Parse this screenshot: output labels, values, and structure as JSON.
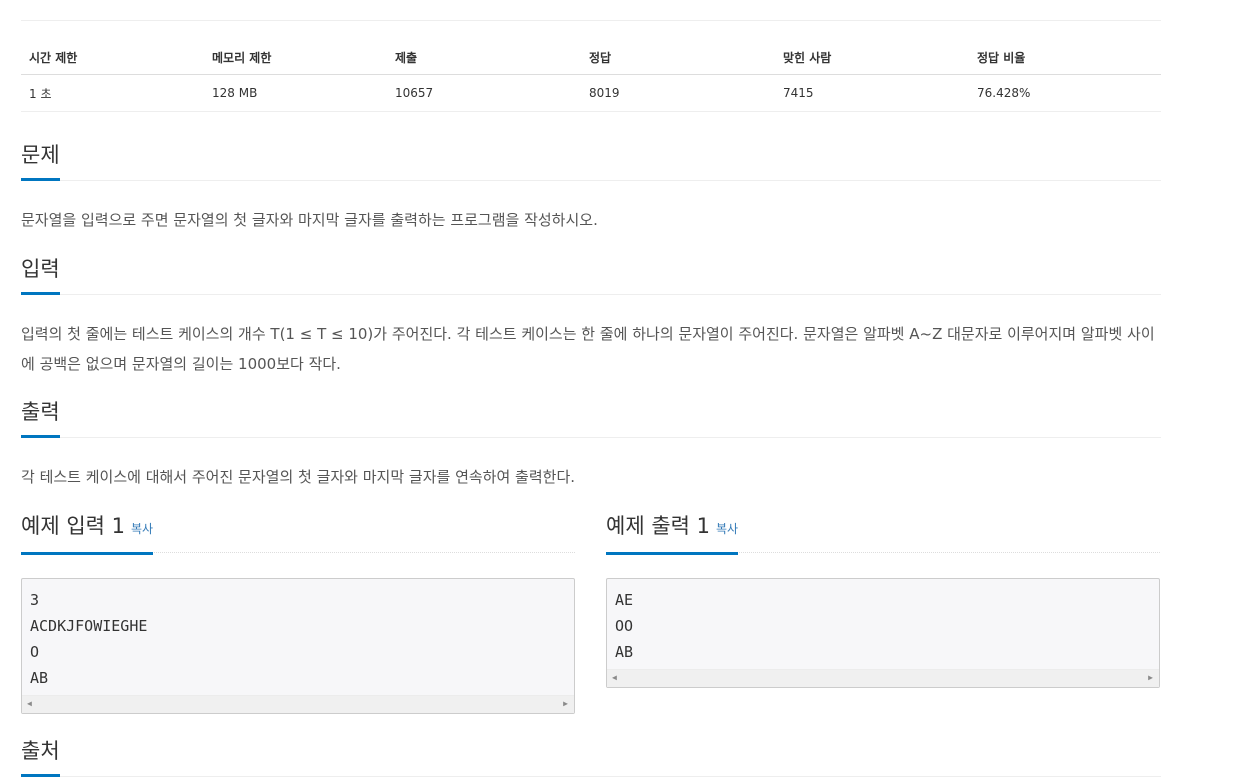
{
  "info_table": {
    "headers": [
      "시간 제한",
      "메모리 제한",
      "제출",
      "정답",
      "맞힌 사람",
      "정답 비율"
    ],
    "values": [
      "1 초",
      "128 MB",
      "10657",
      "8019",
      "7415",
      "76.428%"
    ]
  },
  "sections": {
    "problem": {
      "title": "문제",
      "text": "문자열을 입력으로 주면 문자열의 첫 글자와 마지막 글자를 출력하는 프로그램을 작성하시오."
    },
    "input": {
      "title": "입력",
      "text": "입력의 첫 줄에는 테스트 케이스의 개수 T(1 ≤ T ≤ 10)가 주어진다. 각 테스트 케이스는 한 줄에 하나의 문자열이 주어진다. 문자열은 알파벳 A~Z 대문자로 이루어지며 알파벳 사이에 공백은 없으며 문자열의 길이는 1000보다 작다."
    },
    "output": {
      "title": "출력",
      "text": "각 테스트 케이스에 대해서 주어진 문자열의 첫 글자와 마지막 글자를 연속하여 출력한다."
    },
    "source": {
      "title": "출처"
    }
  },
  "samples": {
    "input": {
      "title": "예제 입력 1",
      "copy_label": "복사",
      "lines": [
        "3",
        "ACDKJFOWIEGHE",
        "O",
        "AB"
      ]
    },
    "output": {
      "title": "예제 출력 1",
      "copy_label": "복사",
      "lines": [
        "AE",
        "OO",
        "AB"
      ]
    }
  },
  "colors": {
    "accent": "#0076c0",
    "link": "#337ab7",
    "code_bg": "#f7f7f9"
  }
}
